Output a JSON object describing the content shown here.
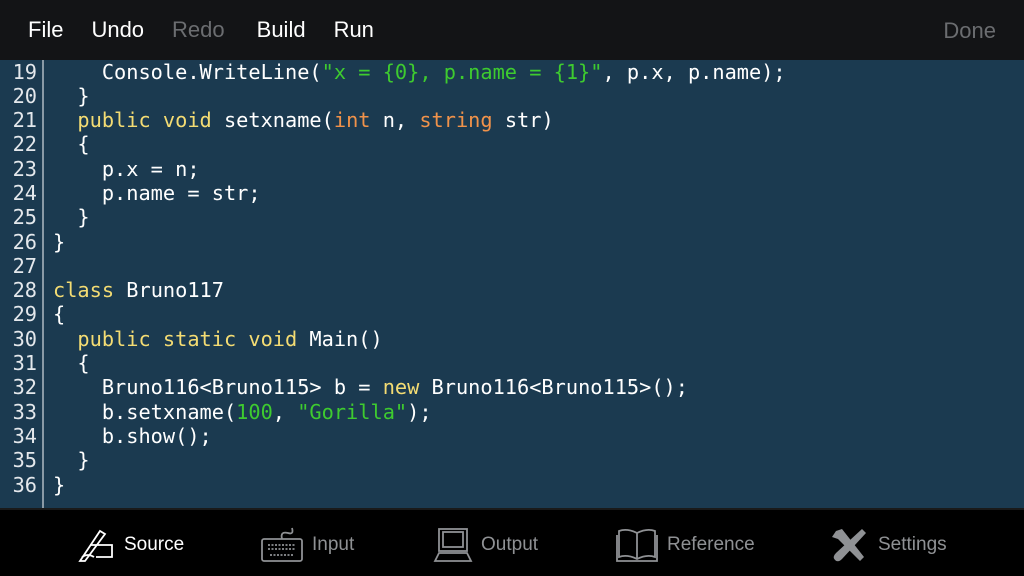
{
  "menu": {
    "file": "File",
    "undo": "Undo",
    "redo": "Redo",
    "build": "Build",
    "run": "Run",
    "done": "Done"
  },
  "editor": {
    "line_numbers": [
      "19",
      "20",
      "21",
      "22",
      "23",
      "24",
      "25",
      "26",
      "27",
      "28",
      "29",
      "30",
      "31",
      "32",
      "33",
      "34",
      "35",
      "36"
    ],
    "lines": [
      [
        [
          "    Console.WriteLine(",
          "p"
        ],
        [
          "\"x = {0}, p.name = {1}\"",
          "s"
        ],
        [
          ", p.x, p.name);",
          "p"
        ]
      ],
      [
        [
          "  }",
          "p"
        ]
      ],
      [
        [
          "  ",
          "p"
        ],
        [
          "public void",
          "k"
        ],
        [
          " setxname(",
          "p"
        ],
        [
          "int",
          "t"
        ],
        [
          " n, ",
          "p"
        ],
        [
          "string",
          "t"
        ],
        [
          " str)",
          "p"
        ]
      ],
      [
        [
          "  {",
          "p"
        ]
      ],
      [
        [
          "    p.x = n;",
          "p"
        ]
      ],
      [
        [
          "    p.name = str;",
          "p"
        ]
      ],
      [
        [
          "  }",
          "p"
        ]
      ],
      [
        [
          "}",
          "p"
        ]
      ],
      [
        [
          "",
          "p"
        ]
      ],
      [
        [
          "class",
          "k"
        ],
        [
          " Bruno117",
          "p"
        ]
      ],
      [
        [
          "{",
          "p"
        ]
      ],
      [
        [
          "  ",
          "p"
        ],
        [
          "public static void",
          "k"
        ],
        [
          " Main()",
          "p"
        ]
      ],
      [
        [
          "  {",
          "p"
        ]
      ],
      [
        [
          "    Bruno116<Bruno115> b = ",
          "p"
        ],
        [
          "new",
          "k"
        ],
        [
          " Bruno116<Bruno115>();",
          "p"
        ]
      ],
      [
        [
          "    b.setxname(",
          "p"
        ],
        [
          "100",
          "n"
        ],
        [
          ", ",
          "p"
        ],
        [
          "\"Gorilla\"",
          "s"
        ],
        [
          ");",
          "p"
        ]
      ],
      [
        [
          "    b.show();",
          "p"
        ]
      ],
      [
        [
          "  }",
          "p"
        ]
      ],
      [
        [
          "}",
          "p"
        ]
      ]
    ]
  },
  "tabs": [
    {
      "label": "Source",
      "icon": "pen-icon",
      "active": true
    },
    {
      "label": "Input",
      "icon": "keyboard-icon",
      "active": false
    },
    {
      "label": "Output",
      "icon": "computer-icon",
      "active": false
    },
    {
      "label": "Reference",
      "icon": "book-icon",
      "active": false
    },
    {
      "label": "Settings",
      "icon": "tools-icon",
      "active": false
    }
  ],
  "colors": {
    "editor_bg": "#1b3a50",
    "keyword": "#f4dc73",
    "type": "#f0924a",
    "string": "#3ecb2f"
  }
}
